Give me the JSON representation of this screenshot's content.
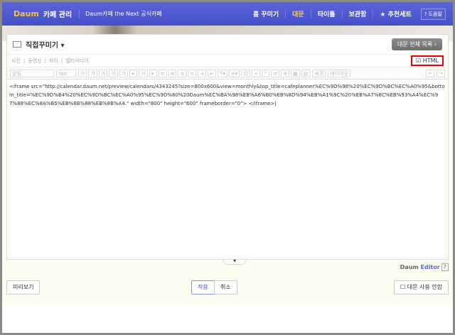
{
  "header": {
    "logo": "Daum",
    "title": "카페 관리",
    "subtitle": "Daum카페 the Next 공식카페",
    "nav": [
      "홈 꾸미기",
      "대문",
      "타이틀",
      "보관함",
      "★ 추천세트"
    ],
    "help": "? 도움말"
  },
  "panel": {
    "title": "직접꾸미기 ▾",
    "list_button": "대문 전체 목록 ›",
    "insert_items": [
      "사진",
      "동영상",
      "파이",
      "멀티미디어"
    ],
    "html_checkbox": "HTML",
    "font": "굴림",
    "size": "9pt",
    "toolbar": [
      "가",
      "가",
      "가",
      "가",
      "가",
      "▾",
      "가",
      "▾",
      "≡",
      "≡",
      "≡",
      "≡",
      "⇥",
      "⇤",
      "T▾",
      "≡▾",
      "☺",
      "∞",
      "“",
      "≡",
      "※",
      "▦",
      "▤"
    ],
    "bg_button": "배경",
    "layout_button": "레이아웃",
    "undo": "↶",
    "redo": "↷",
    "editor_content": "<iframe src=\"http://calendar.daum.net/preview/calendars/4343245?size=800x600&view=monthly&top_title=cafeplanner%EC%9D%98%20%EC%9D%BC%EC%A0%95&bottom_title=%EC%9D%B4%20%EC%9D%BC%EC%A0%95%EC%9D%80%20Daum%EC%BA%98%EB%A6%B0%EB%8D%94%EB%A1%9C%20%EB%A7%8C%EB%93%A4%EC%97%88%EC%8A%B5%EB%8B%88%EB%8B%A4.\" width=\"800\" height=\"600\" frameborder=\"0\"> </iframe>|"
  },
  "footer": {
    "brand1": "Daum",
    "brand2": "Editor",
    "brand_help": "?",
    "preview": "미리보기",
    "apply": "적용",
    "cancel": "취소",
    "no_use": "대문 사용 안함"
  }
}
